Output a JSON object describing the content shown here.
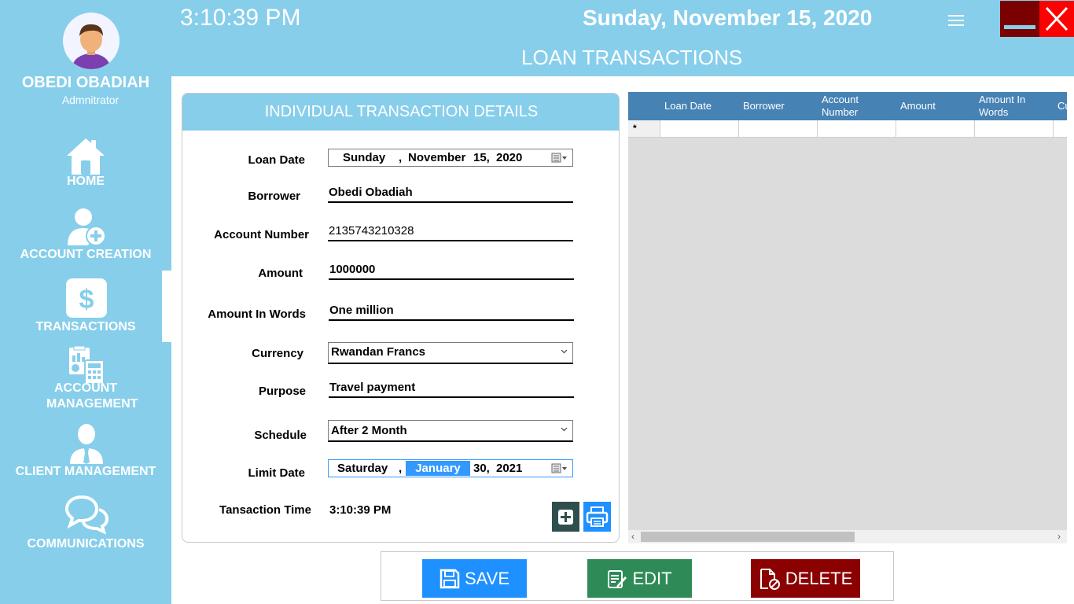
{
  "header": {
    "time": "3:10:39 PM",
    "date": "Sunday, November 15, 2020",
    "page_title": "LOAN TRANSACTIONS"
  },
  "user": {
    "name": "OBEDI OBADIAH",
    "role": "Admnitrator"
  },
  "sidebar": {
    "items": [
      {
        "label": "HOME",
        "icon": "home-icon"
      },
      {
        "label": "ACCOUNT CREATION",
        "icon": "add-user-icon"
      },
      {
        "label": "TRANSACTIONS",
        "icon": "dollar-icon"
      },
      {
        "label": "ACCOUNT MANAGEMENT",
        "icon": "calculator-icon"
      },
      {
        "label": "CLIENT MANAGEMENT",
        "icon": "client-icon"
      },
      {
        "label": "COMMUNICATIONS",
        "icon": "chat-icon"
      }
    ]
  },
  "details": {
    "title": "INDIVIDUAL TRANSACTION DETAILS",
    "loan_date_label": "Loan Date",
    "loan_date": {
      "weekday": "Sunday",
      "month": "November",
      "day": "15,",
      "year": "2020"
    },
    "borrower_label": "Borrower",
    "borrower": "Obedi Obadiah",
    "account_number_label": "Account Number",
    "account_number": "2135743210328",
    "amount_label": "Amount",
    "amount": "1000000",
    "amount_words_label": "Amount In Words",
    "amount_words": "One million",
    "currency_label": "Currency",
    "currency": "Rwandan Francs",
    "purpose_label": "Purpose",
    "purpose": "Travel payment",
    "schedule_label": "Schedule",
    "schedule": "After 2 Month",
    "limit_date_label": "Limit Date",
    "limit_date": {
      "weekday": "Saturday",
      "month": "January",
      "day": "30,",
      "year": "2021"
    },
    "transaction_time_label": "Tansaction Time",
    "transaction_time": "3:10:39 PM",
    "date_separator": ","
  },
  "grid": {
    "columns": [
      "Loan Date",
      "Borrower",
      "Account Number",
      "Amount",
      "Amount In Words",
      "Cu"
    ],
    "new_row_marker": "*"
  },
  "actions": {
    "save": "SAVE",
    "edit": "EDIT",
    "delete": "DELETE"
  },
  "colors": {
    "sky": "#87ceeb",
    "grid_header": "#4682b4",
    "save": "#1e90ff",
    "edit": "#2e8b57",
    "delete": "#8b0000",
    "close": "#ff0000",
    "minimize": "#7b0000"
  }
}
